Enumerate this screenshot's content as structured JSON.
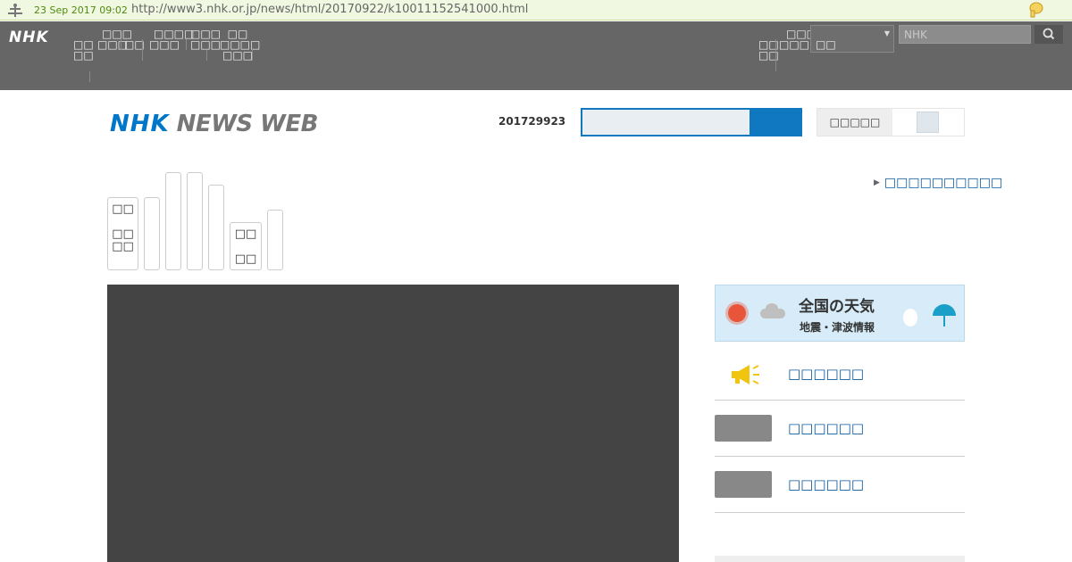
{
  "wayback": {
    "date": "23 Sep 2017 09:02",
    "url": "http://www3.nhk.or.jp/news/html/20170922/k10011152541000.html"
  },
  "global_nav": {
    "logo": "NHK",
    "items": [
      [
        "□□",
        "□□"
      ],
      [
        "□□□",
        "□□□"
      ],
      [
        "□□"
      ],
      [
        "□□□□",
        "□□□"
      ],
      [
        "□□□",
        "□□□"
      ],
      [
        "□□",
        "□□□□",
        "□□□"
      ]
    ],
    "right_items": [
      [
        "□□",
        "□□"
      ],
      [
        "□□□",
        "□□□"
      ]
    ],
    "select_value": "□□",
    "search_placeholder": "NHK"
  },
  "header": {
    "logo_nhk": "NHK",
    "logo_news": "NEWS WEB",
    "date": "201729923",
    "toggle_label": "□□□□□"
  },
  "categories": [
    [
      "□□",
      "□□",
      "□□"
    ],
    [],
    [],
    [],
    [],
    [
      "□□",
      "□□"
    ],
    []
  ],
  "top_link": "□□□□□□□□□□",
  "sidebar": {
    "weather_title": "全国の天気",
    "weather_sub": "地震・津波情報",
    "items": [
      "□□□□□□",
      "□□□□□□",
      "□□□□□□"
    ]
  },
  "colors": {
    "brand_blue": "#0f78c0",
    "nav_gray": "#666666",
    "video_bg": "#444444"
  }
}
